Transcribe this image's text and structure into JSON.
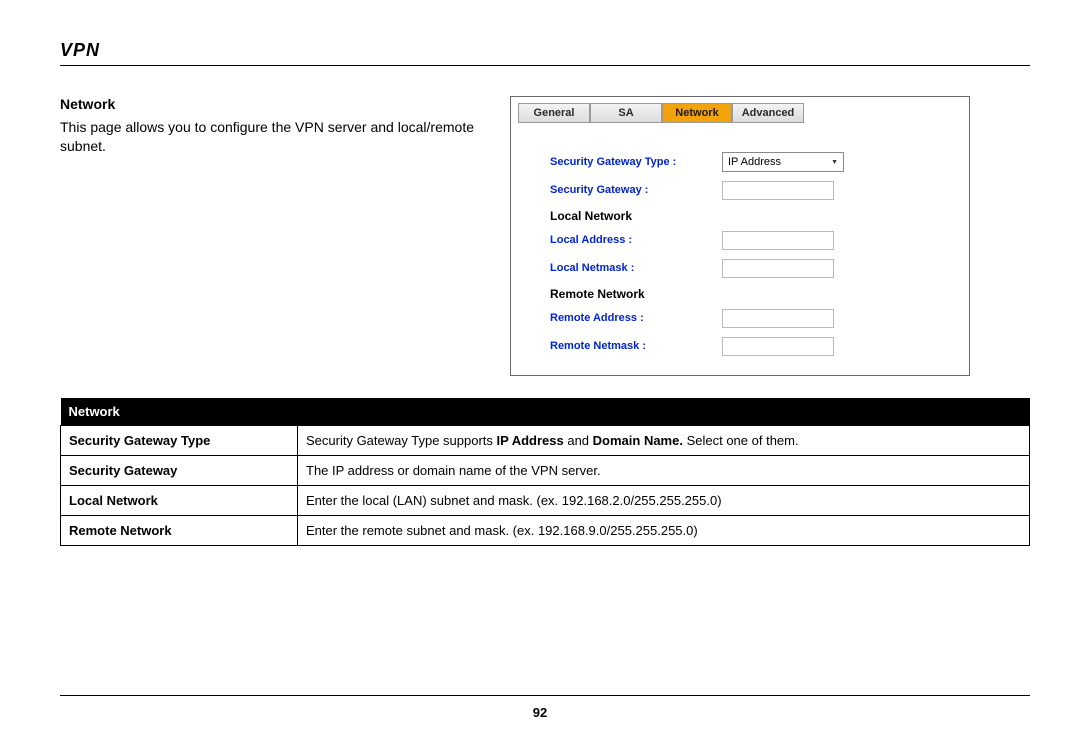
{
  "title": "VPN",
  "intro": {
    "heading": "Network",
    "text": "This page allows you to configure the VPN server and local/remote subnet."
  },
  "screenshot": {
    "tabs": [
      {
        "label": "General",
        "active": false
      },
      {
        "label": "SA",
        "active": false
      },
      {
        "label": "Network",
        "active": true
      },
      {
        "label": "Advanced",
        "active": false
      }
    ],
    "security_gateway_type_label": "Security Gateway Type :",
    "security_gateway_type_value": "IP Address",
    "security_gateway_label": "Security Gateway :",
    "local_network_heading": "Local Network",
    "local_address_label": "Local Address :",
    "local_netmask_label": "Local Netmask :",
    "remote_network_heading": "Remote Network",
    "remote_address_label": "Remote Address :",
    "remote_netmask_label": "Remote Netmask :"
  },
  "param_table": {
    "header": "Network",
    "rows": [
      {
        "name": "Security Gateway Type",
        "desc_pre": "Security Gateway Type supports ",
        "desc_b1": "IP Address",
        "desc_mid": " and ",
        "desc_b2": "Domain Name.",
        "desc_post": " Select one of them."
      },
      {
        "name": "Security Gateway",
        "desc_pre": "The IP address or domain name of the VPN server.",
        "desc_b1": "",
        "desc_mid": "",
        "desc_b2": "",
        "desc_post": ""
      },
      {
        "name": "Local Network",
        "desc_pre": "Enter the local (LAN) subnet and mask. (ex. 192.168.2.0/255.255.255.0)",
        "desc_b1": "",
        "desc_mid": "",
        "desc_b2": "",
        "desc_post": ""
      },
      {
        "name": "Remote Network",
        "desc_pre": "Enter the remote subnet and mask. (ex. 192.168.9.0/255.255.255.0)",
        "desc_b1": "",
        "desc_mid": "",
        "desc_b2": "",
        "desc_post": ""
      }
    ]
  },
  "page_number": "92"
}
